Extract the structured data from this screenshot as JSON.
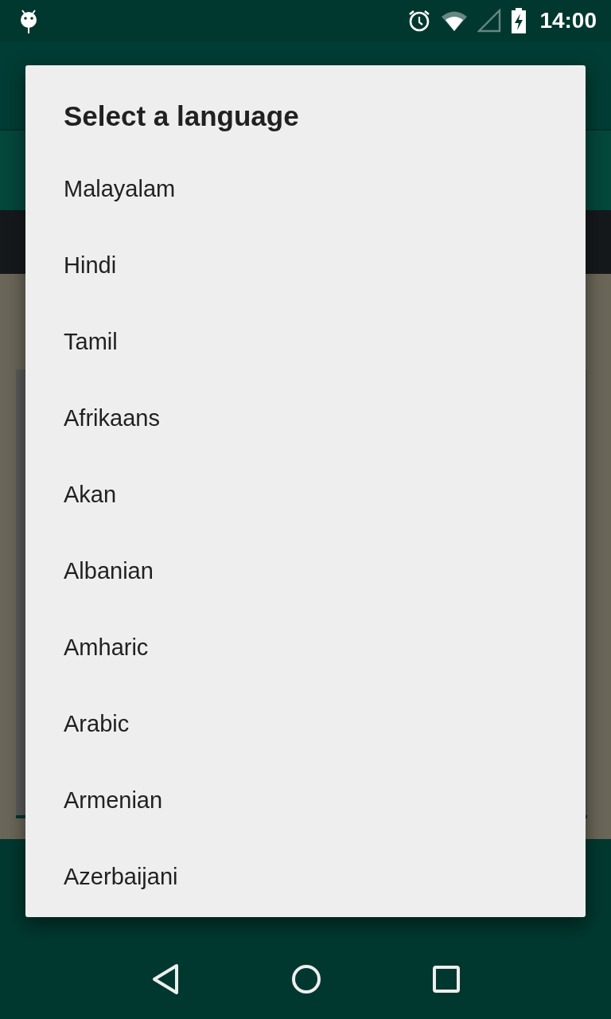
{
  "status_bar": {
    "time": "14:00"
  },
  "dialog": {
    "title": "Select a language",
    "items": [
      {
        "label": "Malayalam"
      },
      {
        "label": "Hindi"
      },
      {
        "label": "Tamil"
      },
      {
        "label": "Afrikaans"
      },
      {
        "label": "Akan"
      },
      {
        "label": "Albanian"
      },
      {
        "label": "Amharic"
      },
      {
        "label": "Arabic"
      },
      {
        "label": "Armenian"
      },
      {
        "label": "Azerbaijani"
      }
    ]
  }
}
